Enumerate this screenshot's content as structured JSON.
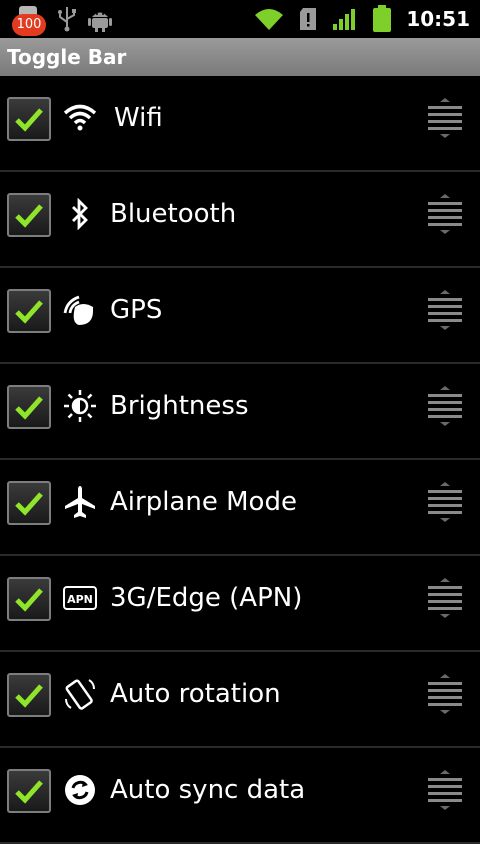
{
  "status_bar": {
    "notification_badge": "100",
    "time": "10:51",
    "icons": [
      "app-badge-icon",
      "usb-icon",
      "android-icon",
      "wifi-signal-icon",
      "sd-card-alert-icon",
      "cell-signal-icon",
      "battery-icon"
    ]
  },
  "title_bar": {
    "title": "Toggle Bar"
  },
  "toggles": [
    {
      "label": "Wifi",
      "icon": "wifi-icon",
      "checked": true
    },
    {
      "label": "Bluetooth",
      "icon": "bluetooth-icon",
      "checked": true
    },
    {
      "label": "GPS",
      "icon": "gps-icon",
      "checked": true
    },
    {
      "label": "Brightness",
      "icon": "brightness-icon",
      "checked": true
    },
    {
      "label": "Airplane Mode",
      "icon": "airplane-icon",
      "checked": true
    },
    {
      "label": "3G/Edge (APN)",
      "icon": "apn-icon",
      "icon_text": "APN",
      "checked": true
    },
    {
      "label": "Auto rotation",
      "icon": "rotation-icon",
      "checked": true
    },
    {
      "label": "Auto sync data",
      "icon": "sync-icon",
      "checked": true
    }
  ],
  "colors": {
    "check": "#8ee52a",
    "title_bar": "#8a8a8a",
    "background": "#000000",
    "badge": "#e23b1f"
  }
}
